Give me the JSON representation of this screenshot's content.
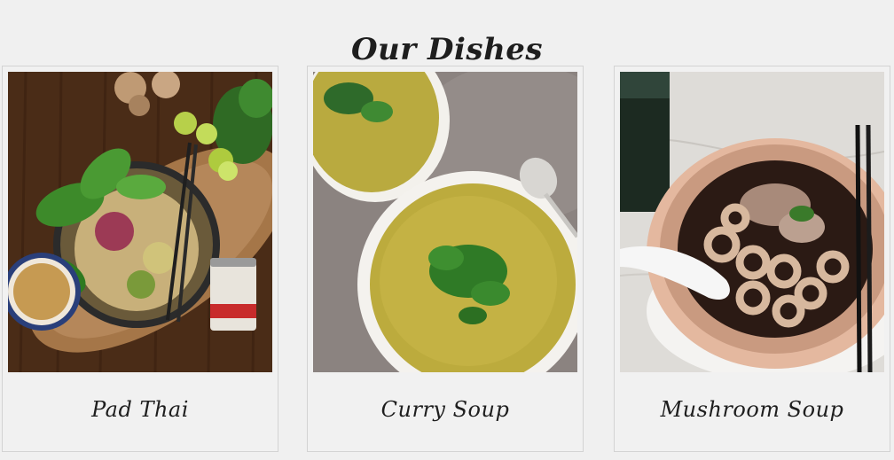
{
  "section": {
    "title": "Our Dishes"
  },
  "dishes": [
    {
      "name": "Pad Thai",
      "photo_icon": "pad-thai-photo"
    },
    {
      "name": "Curry Soup",
      "photo_icon": "curry-soup-photo"
    },
    {
      "name": "Mushroom Soup",
      "photo_icon": "mushroom-soup-photo"
    }
  ],
  "colors": {
    "background": "#f0f0f0",
    "card_border": "#d3d3d3",
    "text": "#1e1e1e"
  }
}
